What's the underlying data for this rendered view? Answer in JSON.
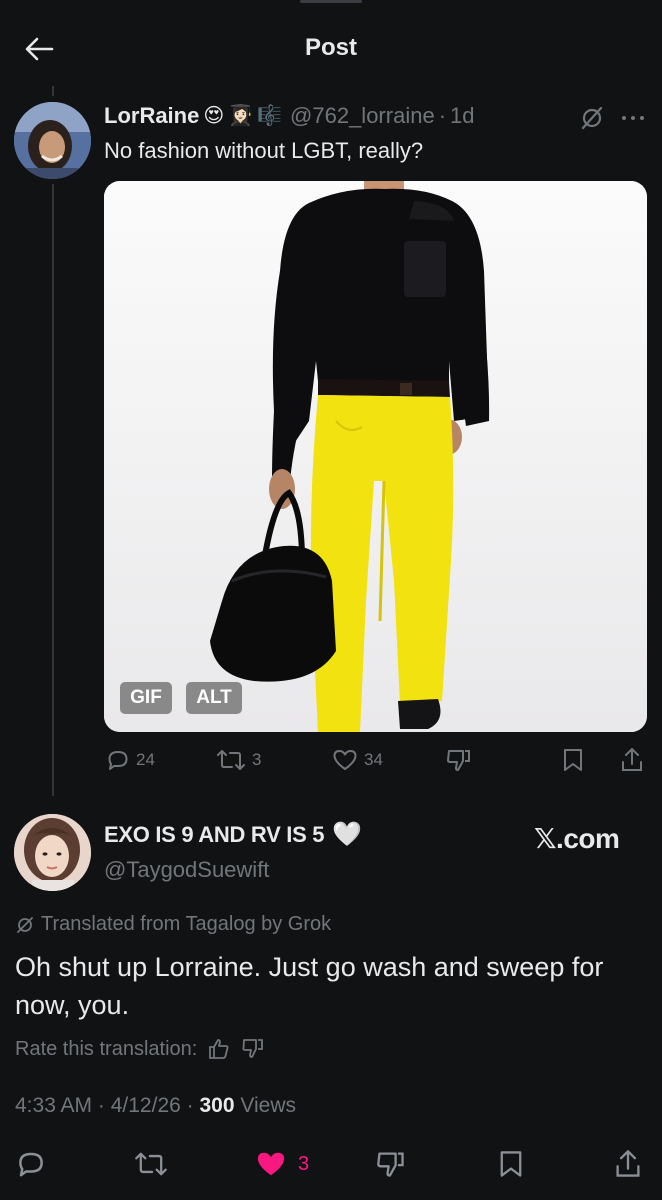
{
  "header": {
    "title": "Post"
  },
  "post": {
    "display_name": "LorRaine",
    "name_emojis": [
      "😍",
      "👩🏻‍🎓",
      "🎼"
    ],
    "handle": "@762_lorraine",
    "time": "1d",
    "text": "No fashion without LGBT, really?",
    "media": {
      "badges": [
        "GIF",
        "ALT"
      ]
    },
    "actions": {
      "replies": "24",
      "reposts": "3",
      "likes": "34"
    }
  },
  "reply": {
    "display_name": "EXO IS 9 AND RV IS 5",
    "name_emoji": "🤍",
    "handle": "@TaygodSuewift",
    "watermark": "𝕏.com",
    "translated_label": "Translated from Tagalog by Grok",
    "text": "Oh shut up Lorraine. Just go wash and sweep for now, you.",
    "rate_label": "Rate this translation:",
    "time": "4:33 AM",
    "date": "4/12/26",
    "views_count": "300",
    "views_label": "Views",
    "likes": "3"
  },
  "colors": {
    "background": "#111214",
    "muted": "#71767b",
    "like_pink": "#f91880",
    "pants_yellow": "#f2e20f"
  }
}
